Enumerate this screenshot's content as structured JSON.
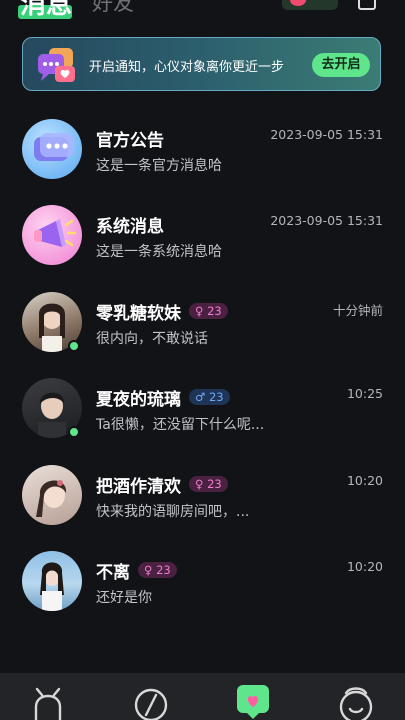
{
  "header": {
    "tab_messages": "消息",
    "tab_friends": "好友"
  },
  "banner": {
    "text": "开启通知，心仪对象离你更近一步",
    "button": "去开启"
  },
  "conversations": [
    {
      "name": "官方公告",
      "time": "2023-09-05  15:31",
      "message": "这是一条官方消息哈"
    },
    {
      "name": "系统消息",
      "time": "2023-09-05  15:31",
      "message": "这是一条系统消息哈"
    },
    {
      "name": "零乳糖软妹",
      "gender": "♀",
      "age": "23",
      "time": "十分钟前",
      "message": "很内向，不敢说话",
      "online": true
    },
    {
      "name": "夏夜的琉璃",
      "gender": "♂",
      "age": "23",
      "time": "10:25",
      "message": "Ta很懒，还没留下什么呢...",
      "online": true
    },
    {
      "name": "把酒作清欢",
      "gender": "♀",
      "age": "23",
      "time": "10:20",
      "message": "快来我的语聊房间吧，..."
    },
    {
      "name": "不离",
      "gender": "♀",
      "age": "23",
      "time": "10:20",
      "message": "还好是你"
    }
  ],
  "colors": {
    "accent": "#5fe58c",
    "background": "#121316",
    "female": "#ee7fd1",
    "male": "#6fa7f0"
  }
}
